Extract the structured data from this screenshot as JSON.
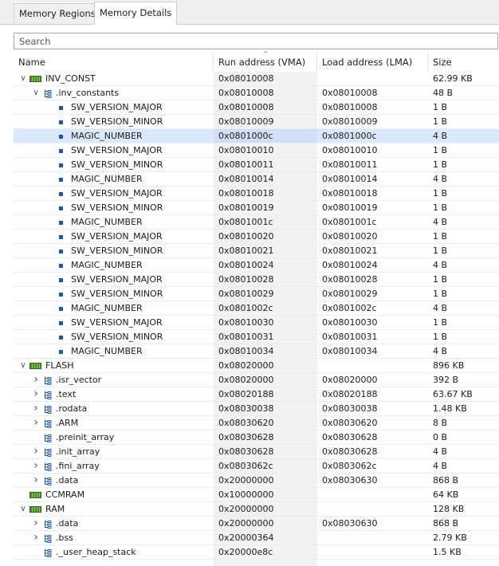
{
  "tabs": [
    {
      "label": "Memory Regions",
      "active": false
    },
    {
      "label": "Memory Details",
      "active": true
    }
  ],
  "search": {
    "placeholder": "Search"
  },
  "columns": {
    "name": "Name",
    "vma": "Run address (VMA)",
    "lma": "Load address (LMA)",
    "size": "Size"
  },
  "rows": [
    {
      "level": 0,
      "toggle": "expanded",
      "icon": "memory-region-icon",
      "name": "INV_CONST",
      "vma": "0x08010008",
      "lma": "",
      "size": "62.99 KB"
    },
    {
      "level": 1,
      "toggle": "expanded",
      "icon": "section-icon",
      "name": ".inv_constants",
      "vma": "0x08010008",
      "lma": "0x08010008",
      "size": "48 B"
    },
    {
      "level": 2,
      "toggle": "none",
      "icon": "symbol-icon",
      "name": "SW_VERSION_MAJOR",
      "vma": "0x08010008",
      "lma": "0x08010008",
      "size": "1 B"
    },
    {
      "level": 2,
      "toggle": "none",
      "icon": "symbol-icon",
      "name": "SW_VERSION_MINOR",
      "vma": "0x08010009",
      "lma": "0x08010009",
      "size": "1 B"
    },
    {
      "level": 2,
      "toggle": "none",
      "icon": "symbol-icon",
      "name": "MAGIC_NUMBER",
      "vma": "0x0801000c",
      "lma": "0x0801000c",
      "size": "4 B",
      "selected": true
    },
    {
      "level": 2,
      "toggle": "none",
      "icon": "symbol-icon",
      "name": "SW_VERSION_MAJOR",
      "vma": "0x08010010",
      "lma": "0x08010010",
      "size": "1 B"
    },
    {
      "level": 2,
      "toggle": "none",
      "icon": "symbol-icon",
      "name": "SW_VERSION_MINOR",
      "vma": "0x08010011",
      "lma": "0x08010011",
      "size": "1 B"
    },
    {
      "level": 2,
      "toggle": "none",
      "icon": "symbol-icon",
      "name": "MAGIC_NUMBER",
      "vma": "0x08010014",
      "lma": "0x08010014",
      "size": "4 B"
    },
    {
      "level": 2,
      "toggle": "none",
      "icon": "symbol-icon",
      "name": "SW_VERSION_MAJOR",
      "vma": "0x08010018",
      "lma": "0x08010018",
      "size": "1 B"
    },
    {
      "level": 2,
      "toggle": "none",
      "icon": "symbol-icon",
      "name": "SW_VERSION_MINOR",
      "vma": "0x08010019",
      "lma": "0x08010019",
      "size": "1 B"
    },
    {
      "level": 2,
      "toggle": "none",
      "icon": "symbol-icon",
      "name": "MAGIC_NUMBER",
      "vma": "0x0801001c",
      "lma": "0x0801001c",
      "size": "4 B"
    },
    {
      "level": 2,
      "toggle": "none",
      "icon": "symbol-icon",
      "name": "SW_VERSION_MAJOR",
      "vma": "0x08010020",
      "lma": "0x08010020",
      "size": "1 B"
    },
    {
      "level": 2,
      "toggle": "none",
      "icon": "symbol-icon",
      "name": "SW_VERSION_MINOR",
      "vma": "0x08010021",
      "lma": "0x08010021",
      "size": "1 B"
    },
    {
      "level": 2,
      "toggle": "none",
      "icon": "symbol-icon",
      "name": "MAGIC_NUMBER",
      "vma": "0x08010024",
      "lma": "0x08010024",
      "size": "4 B"
    },
    {
      "level": 2,
      "toggle": "none",
      "icon": "symbol-icon",
      "name": "SW_VERSION_MAJOR",
      "vma": "0x08010028",
      "lma": "0x08010028",
      "size": "1 B"
    },
    {
      "level": 2,
      "toggle": "none",
      "icon": "symbol-icon",
      "name": "SW_VERSION_MINOR",
      "vma": "0x08010029",
      "lma": "0x08010029",
      "size": "1 B"
    },
    {
      "level": 2,
      "toggle": "none",
      "icon": "symbol-icon",
      "name": "MAGIC_NUMBER",
      "vma": "0x0801002c",
      "lma": "0x0801002c",
      "size": "4 B"
    },
    {
      "level": 2,
      "toggle": "none",
      "icon": "symbol-icon",
      "name": "SW_VERSION_MAJOR",
      "vma": "0x08010030",
      "lma": "0x08010030",
      "size": "1 B"
    },
    {
      "level": 2,
      "toggle": "none",
      "icon": "symbol-icon",
      "name": "SW_VERSION_MINOR",
      "vma": "0x08010031",
      "lma": "0x08010031",
      "size": "1 B"
    },
    {
      "level": 2,
      "toggle": "none",
      "icon": "symbol-icon",
      "name": "MAGIC_NUMBER",
      "vma": "0x08010034",
      "lma": "0x08010034",
      "size": "4 B"
    },
    {
      "level": 0,
      "toggle": "expanded",
      "icon": "memory-region-icon",
      "name": "FLASH",
      "vma": "0x08020000",
      "lma": "",
      "size": "896 KB"
    },
    {
      "level": 1,
      "toggle": "collapsed",
      "icon": "section-icon",
      "name": ".isr_vector",
      "vma": "0x08020000",
      "lma": "0x08020000",
      "size": "392 B"
    },
    {
      "level": 1,
      "toggle": "collapsed",
      "icon": "section-icon",
      "name": ".text",
      "vma": "0x08020188",
      "lma": "0x08020188",
      "size": "63.67 KB"
    },
    {
      "level": 1,
      "toggle": "collapsed",
      "icon": "section-icon",
      "name": ".rodata",
      "vma": "0x08030038",
      "lma": "0x08030038",
      "size": "1.48 KB"
    },
    {
      "level": 1,
      "toggle": "collapsed",
      "icon": "section-icon",
      "name": ".ARM",
      "vma": "0x08030620",
      "lma": "0x08030620",
      "size": "8 B"
    },
    {
      "level": 1,
      "toggle": "none",
      "icon": "section-icon",
      "name": ".preinit_array",
      "vma": "0x08030628",
      "lma": "0x08030628",
      "size": "0 B"
    },
    {
      "level": 1,
      "toggle": "collapsed",
      "icon": "section-icon",
      "name": ".init_array",
      "vma": "0x08030628",
      "lma": "0x08030628",
      "size": "4 B"
    },
    {
      "level": 1,
      "toggle": "collapsed",
      "icon": "section-icon",
      "name": ".fini_array",
      "vma": "0x0803062c",
      "lma": "0x0803062c",
      "size": "4 B"
    },
    {
      "level": 1,
      "toggle": "collapsed",
      "icon": "section-icon",
      "name": ".data",
      "vma": "0x20000000",
      "lma": "0x08030630",
      "size": "868 B"
    },
    {
      "level": 0,
      "toggle": "none",
      "icon": "memory-region-icon",
      "name": "CCMRAM",
      "vma": "0x10000000",
      "lma": "",
      "size": "64 KB"
    },
    {
      "level": 0,
      "toggle": "expanded",
      "icon": "memory-region-icon",
      "name": "RAM",
      "vma": "0x20000000",
      "lma": "",
      "size": "128 KB"
    },
    {
      "level": 1,
      "toggle": "collapsed",
      "icon": "section-icon",
      "name": ".data",
      "vma": "0x20000000",
      "lma": "0x08030630",
      "size": "868 B"
    },
    {
      "level": 1,
      "toggle": "collapsed",
      "icon": "section-icon",
      "name": ".bss",
      "vma": "0x20000364",
      "lma": "",
      "size": "2.79 KB"
    },
    {
      "level": 1,
      "toggle": "none",
      "icon": "section-icon",
      "name": "._user_heap_stack",
      "vma": "0x20000e8c",
      "lma": "",
      "size": "1.5 KB"
    }
  ],
  "colors": {
    "selected_row": "#d9e8fb",
    "vma_column_bg": "#f2f2f2",
    "symbol_icon": "#2257a8",
    "memory_icon": "#4a8a2a"
  }
}
